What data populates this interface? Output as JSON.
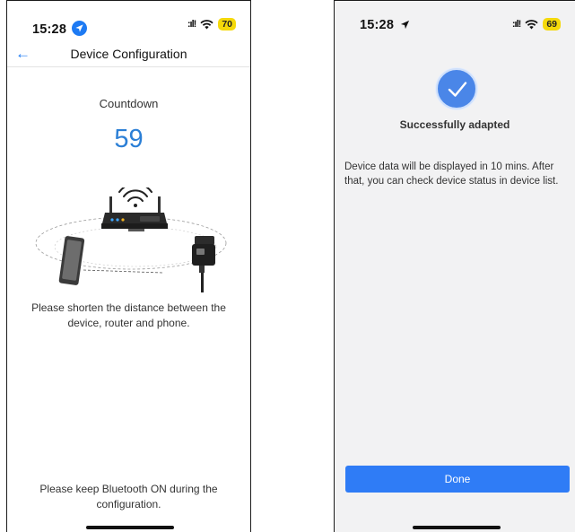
{
  "left_screen": {
    "status_bar": {
      "time": "15:28",
      "signal": ":ıl!",
      "battery": "70"
    },
    "nav": {
      "title": "Device Configuration",
      "back_icon": "back-arrow-icon"
    },
    "countdown": {
      "label": "Countdown",
      "value": "59"
    },
    "instruction": "Please shorten the distance between the device, router and phone.",
    "bluetooth_note": "Please keep Bluetooth ON during the configuration."
  },
  "right_screen": {
    "status_bar": {
      "time": "15:28",
      "signal": ":ıl!",
      "battery": "69"
    },
    "success": {
      "title": "Successfully adapted",
      "description": "Device data will be displayed in 10 mins. After that, you can check device status in device list."
    },
    "done_button": "Done"
  },
  "colors": {
    "accent": "#1d7af3",
    "countdown": "#2b7fd6",
    "button": "#2f7cf6",
    "battery": "#f5d90a",
    "success_icon": "#4a86e8"
  }
}
